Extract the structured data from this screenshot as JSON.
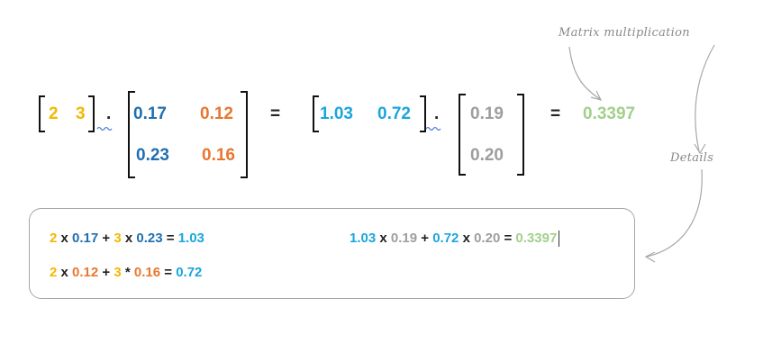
{
  "colors": {
    "yellow": "#f2b800",
    "blue": "#1f6fb0",
    "orange": "#e8772e",
    "cyan": "#1aa6dd",
    "gray": "#9e9e9e",
    "green": "#a3cf8c",
    "note": "#8a8a8a"
  },
  "annotations": {
    "top": "Matrix multiplication",
    "side": "Details"
  },
  "equation": {
    "v1": [
      "2",
      "3"
    ],
    "dot": ".",
    "m1": [
      [
        "0.17",
        "0.12"
      ],
      [
        "0.23",
        "0.16"
      ]
    ],
    "equals": "=",
    "v2": [
      "1.03",
      "0.72"
    ],
    "m2": [
      "0.19",
      "0.20"
    ],
    "result": "0.3397"
  },
  "details": {
    "line1": {
      "a": "2",
      "x1": "x",
      "b": "0.17",
      "plus": "+",
      "c": "3",
      "x2": "x",
      "d": "0.23",
      "eq": "=",
      "r": "1.03"
    },
    "line2": {
      "a": "2",
      "x1": "x",
      "b": "0.12",
      "plus": "+",
      "c": "3",
      "x2": "*",
      "d": "0.16",
      "eq": "=",
      "r": "0.72"
    },
    "line3": {
      "a": "1.03",
      "x1": "x",
      "b": "0.19",
      "plus": "+",
      "c": "0.72",
      "x2": "x",
      "d": "0.20",
      "eq": "=",
      "r": "0.3397"
    }
  }
}
